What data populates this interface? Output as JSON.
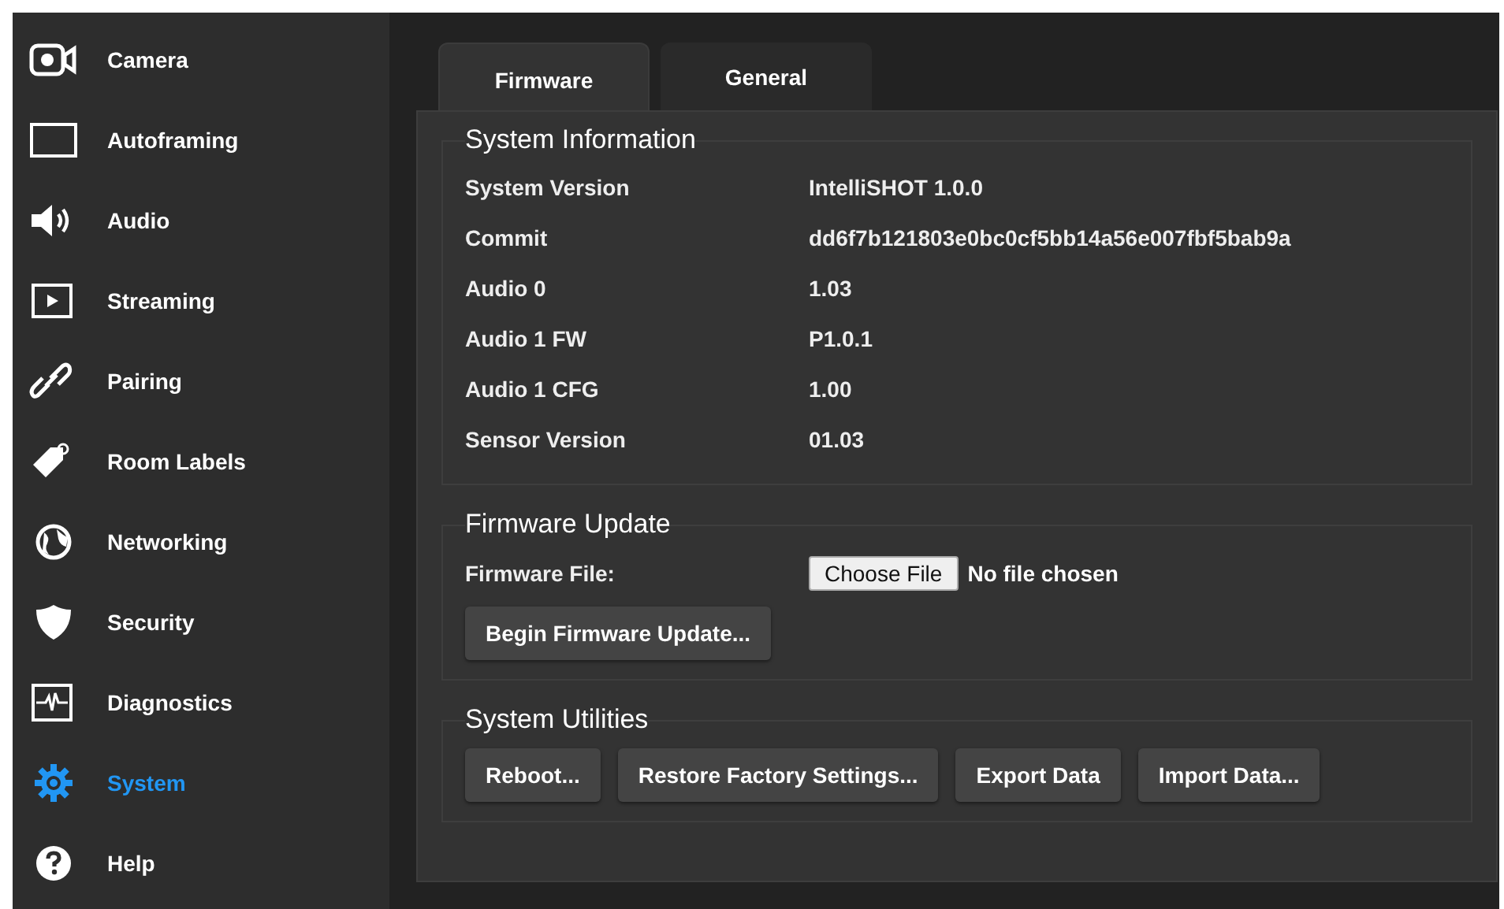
{
  "sidebar": {
    "items": [
      {
        "label": "Camera",
        "kind": "camera",
        "selected": false
      },
      {
        "label": "Autoframing",
        "kind": "frame",
        "selected": false
      },
      {
        "label": "Audio",
        "kind": "speaker",
        "selected": false
      },
      {
        "label": "Streaming",
        "kind": "play",
        "selected": false
      },
      {
        "label": "Pairing",
        "kind": "link",
        "selected": false
      },
      {
        "label": "Room Labels",
        "kind": "tag",
        "selected": false
      },
      {
        "label": "Networking",
        "kind": "globe",
        "selected": false
      },
      {
        "label": "Security",
        "kind": "shield",
        "selected": false
      },
      {
        "label": "Diagnostics",
        "kind": "pulse",
        "selected": false
      },
      {
        "label": "System",
        "kind": "gear",
        "selected": true
      },
      {
        "label": "Help",
        "kind": "help",
        "selected": false
      }
    ]
  },
  "tabs": [
    {
      "label": "Firmware",
      "selected": true
    },
    {
      "label": "General",
      "selected": false
    }
  ],
  "system_information": {
    "title": "System Information",
    "rows": [
      {
        "label": "System Version",
        "value": "IntelliSHOT 1.0.0"
      },
      {
        "label": "Commit",
        "value": "dd6f7b121803e0bc0cf5bb14a56e007fbf5bab9a"
      },
      {
        "label": "Audio 0",
        "value": "1.03"
      },
      {
        "label": "Audio 1 FW",
        "value": "P1.0.1"
      },
      {
        "label": "Audio 1 CFG",
        "value": "1.00"
      },
      {
        "label": "Sensor Version",
        "value": "01.03"
      }
    ]
  },
  "firmware_update": {
    "title": "Firmware Update",
    "file_label": "Firmware File:",
    "choose_button": "Choose File",
    "file_status": "No file chosen",
    "begin_button": "Begin Firmware Update..."
  },
  "system_utilities": {
    "title": "System Utilities",
    "buttons": [
      "Reboot...",
      "Restore Factory Settings...",
      "Export Data",
      "Import Data..."
    ]
  }
}
